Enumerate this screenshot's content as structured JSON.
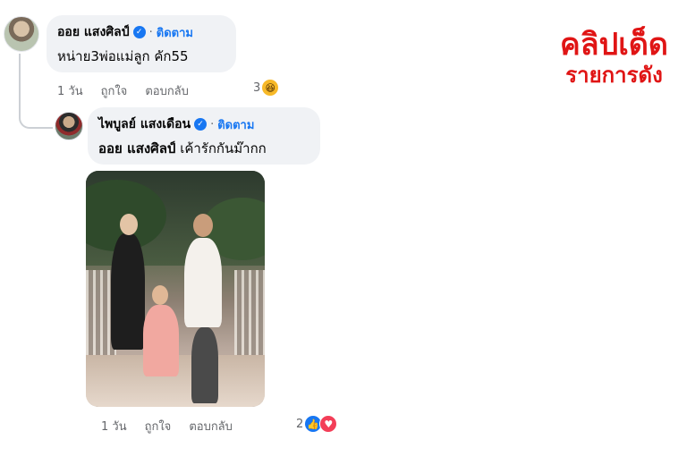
{
  "comment1": {
    "author": "ออย แสงศิลป์",
    "separator": "·",
    "follow_label": "ติดตาม",
    "text": "หน่าย3พ่อแม่ลูก คัก55",
    "time": "1 วัน",
    "like_label": "ถูกใจ",
    "reply_label": "ตอบกลับ",
    "reaction_count": "3",
    "reaction_icons": [
      "haha-icon"
    ]
  },
  "reply1": {
    "author": "ไพบูลย์ แสงเดือน",
    "separator": "·",
    "follow_label": "ติดตาม",
    "mention": "ออย แสงศิลป์",
    "text": "เค้ารักกันม๊ากก",
    "time": "1 วัน",
    "like_label": "ถูกใจ",
    "reply_label": "ตอบกลับ",
    "reaction_count": "2",
    "reaction_icons": [
      "like-icon",
      "love-icon"
    ]
  },
  "watermark": {
    "line1": "คลิปเด็ด",
    "line2": "รายการดัง",
    "color": "#e01515"
  },
  "colors": {
    "accent": "#1877f2",
    "bubble": "#f0f2f5",
    "secondary_text": "#65676b"
  }
}
